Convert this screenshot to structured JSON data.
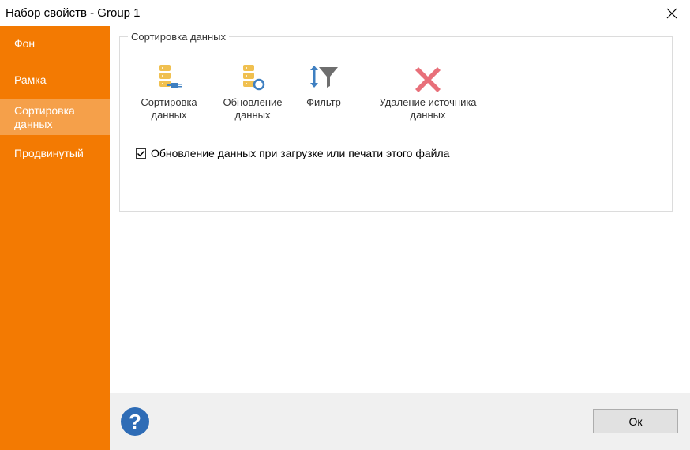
{
  "window": {
    "title": "Набор свойств - Group 1"
  },
  "sidebar": {
    "items": [
      {
        "label": "Фон"
      },
      {
        "label": "Рамка"
      },
      {
        "label": "Сортировка данных",
        "active": true
      },
      {
        "label": "Продвинутый"
      }
    ]
  },
  "group": {
    "title": "Сортировка данных",
    "tools": [
      {
        "label": "Сортировка данных",
        "icon": "data-source-plug-icon"
      },
      {
        "label": "Обновление данных",
        "icon": "data-refresh-icon"
      },
      {
        "label": "Фильтр",
        "icon": "filter-funnel-icon"
      },
      {
        "label": "Удаление источника данных",
        "icon": "delete-x-icon"
      }
    ],
    "checkbox": {
      "label": "Обновление данных при загрузке или печати этого файла",
      "checked": true
    }
  },
  "footer": {
    "ok_label": "Ок",
    "help_symbol": "?"
  },
  "colors": {
    "sidebar": "#f37a02",
    "sidebar_active": "#f5a04a",
    "delete": "#e8707a",
    "filter": "#3e7fc1",
    "db": "#f0c050",
    "help": "#2e6cb6"
  }
}
